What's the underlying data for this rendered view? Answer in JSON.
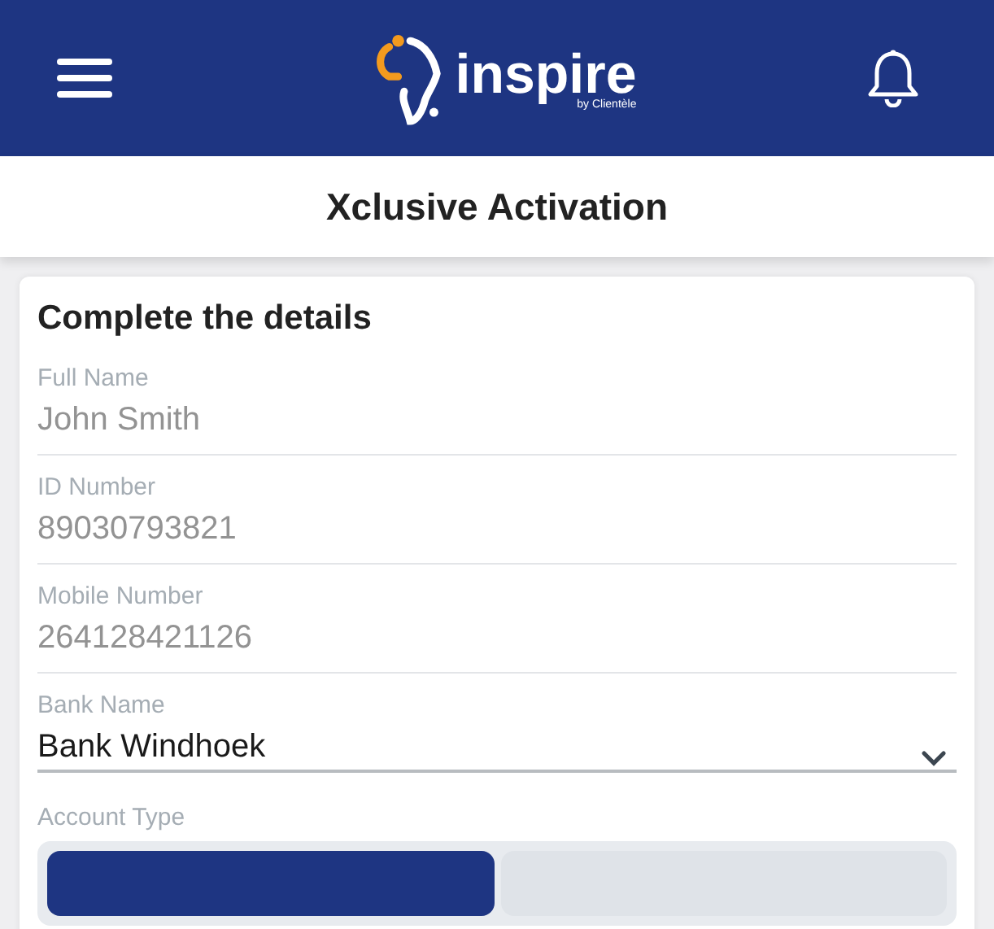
{
  "header": {
    "logo_text": "inspire",
    "logo_subtext": "by Clientèle"
  },
  "title": "Xclusive Activation",
  "form": {
    "heading": "Complete the details",
    "fields": [
      {
        "kind": "readonly",
        "label": "Full Name",
        "value": "John Smith"
      },
      {
        "kind": "readonly",
        "label": "ID Number",
        "value": "89030793821"
      },
      {
        "kind": "readonly",
        "label": "Mobile Number",
        "value": "264128421126"
      },
      {
        "kind": "select",
        "label": "Bank Name",
        "value": "Bank Windhoek"
      }
    ],
    "account_type": {
      "label": "Account Type",
      "segments": [
        {
          "selected": true
        },
        {
          "selected": false
        }
      ]
    }
  }
}
